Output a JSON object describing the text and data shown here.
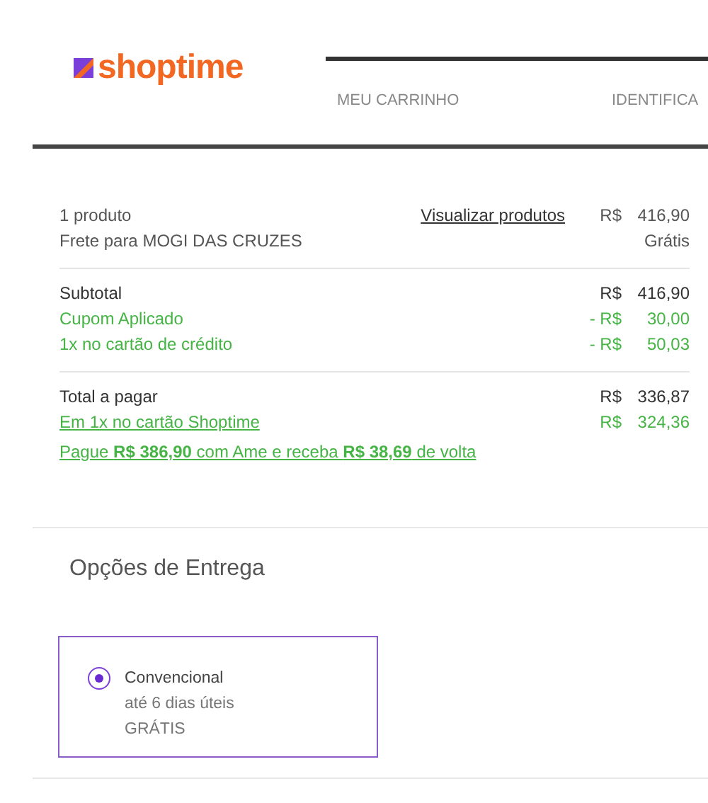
{
  "header": {
    "logo": "shoptime",
    "steps": [
      {
        "label": "MEU CARRINHO"
      },
      {
        "label": "IDENTIFICA"
      }
    ]
  },
  "summary": {
    "groups": [
      [
        {
          "kind": "product",
          "label": "1 produto",
          "link": "Visualizar produtos",
          "currency": "R$",
          "amount": "416,90"
        },
        {
          "kind": "plain",
          "label": "Frete para MOGI DAS CRUZES",
          "amount": "Grátis"
        }
      ],
      [
        {
          "kind": "total",
          "label": "Subtotal",
          "currency": "R$",
          "amount": "416,90"
        },
        {
          "kind": "discount",
          "label": "Cupom Aplicado",
          "currency": "- R$",
          "amount": "30,00"
        },
        {
          "kind": "discount",
          "label": "1x no cartão de crédito",
          "currency": "- R$",
          "amount": "50,03"
        }
      ],
      [
        {
          "kind": "total",
          "label": "Total a pagar",
          "currency": "R$",
          "amount": "336,87"
        },
        {
          "kind": "offer",
          "label": "Em 1x no cartão Shoptime",
          "currency": "R$",
          "amount": "324,36"
        },
        {
          "kind": "promo",
          "label": "Pague **R$ 386,90** com Ame e receba **R$ 38,69** de volta"
        }
      ]
    ]
  },
  "delivery": {
    "title": "Opções de Entrega",
    "options": [
      {
        "name": "Convencional",
        "time": "até 6 dias úteis",
        "price": "GRÁTIS",
        "selected": true
      }
    ]
  }
}
